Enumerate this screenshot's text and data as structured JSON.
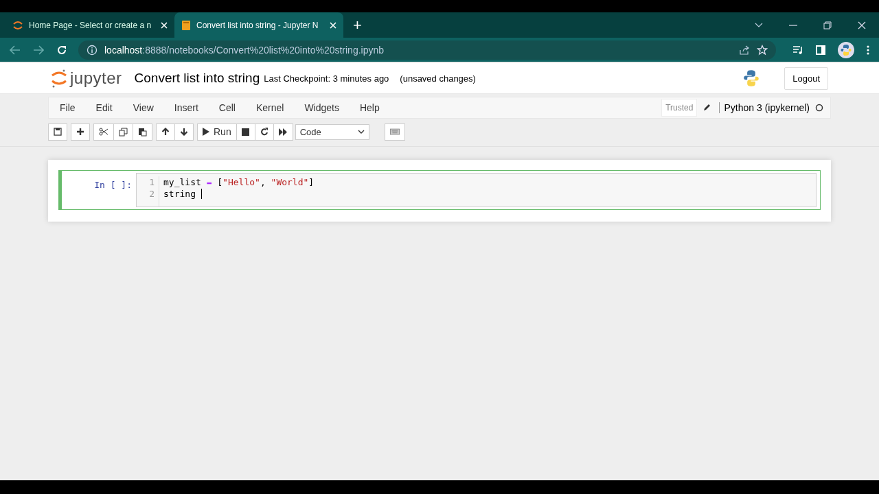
{
  "browser": {
    "tabs": [
      {
        "title": "Home Page - Select or create a n",
        "selected": false,
        "kind": "spinner"
      },
      {
        "title": "Convert list into string - Jupyter N",
        "selected": true,
        "kind": "book"
      }
    ],
    "new_tab": "+",
    "url": "**localhost**:8888/notebooks/Convert%20list%20into%20string.ipynb"
  },
  "header": {
    "logo": "jupyter",
    "notebook_name": "Convert list into string",
    "checkpoint": "Last Checkpoint: 3 minutes ago",
    "autosave": "(unsaved changes)",
    "logout": "Logout"
  },
  "menu": [
    "File",
    "Edit",
    "View",
    "Insert",
    "Cell",
    "Kernel",
    "Widgets",
    "Help"
  ],
  "kernel": {
    "trusted": "Trusted",
    "name": "Python 3 (ipykernel)",
    "busy": false
  },
  "toolbar": {
    "run": "Run",
    "cell_type": "Code"
  },
  "cell": {
    "prompt": "In [ ]:",
    "selected": true,
    "lines": [
      {
        "number": "1",
        "tokens": [
          {
            "text": "my_list ",
            "kind": "name"
          },
          {
            "text": "=",
            "kind": "op"
          },
          {
            "text": " [",
            "kind": "punct"
          },
          {
            "text": "\"Hello\"",
            "kind": "string"
          },
          {
            "text": ", ",
            "kind": "punct"
          },
          {
            "text": "\"World\"",
            "kind": "string"
          },
          {
            "text": "]",
            "kind": "punct"
          }
        ]
      },
      {
        "number": "2",
        "tokens": [
          {
            "text": "string ",
            "kind": "name"
          }
        ],
        "cursor": true
      }
    ]
  }
}
